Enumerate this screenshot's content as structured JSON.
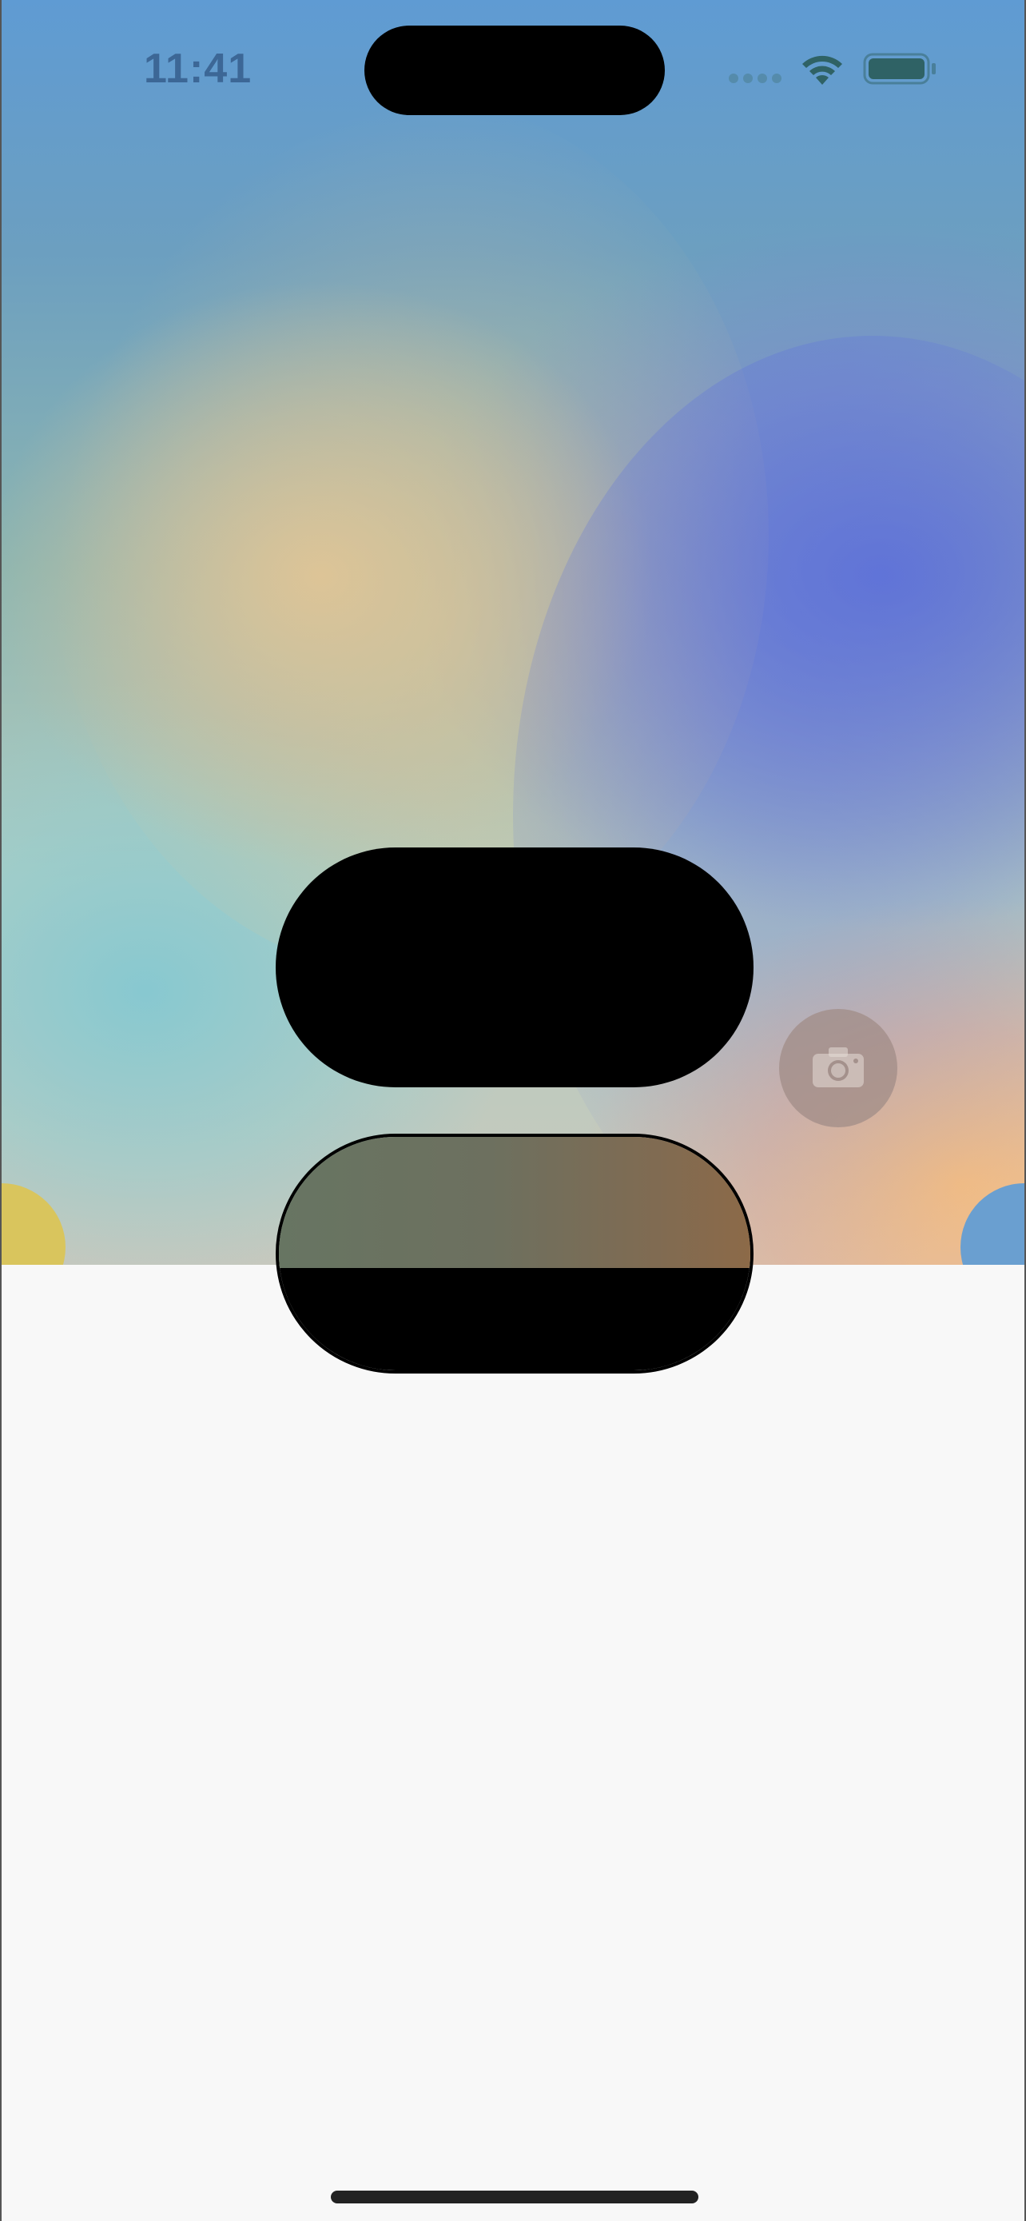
{
  "status_bar": {
    "time": "11:41",
    "wifi_icon": "wifi-icon",
    "battery_icon": "battery-icon",
    "signal_icon": "cellular-signal-dots"
  },
  "lock_screen": {
    "camera_icon": "camera-icon",
    "accent_colors": {
      "time_text": "#3c6796",
      "wallpaper_blue": "#5f9bd3",
      "wallpaper_peach": "#f5be82",
      "pill": "#000000"
    }
  }
}
